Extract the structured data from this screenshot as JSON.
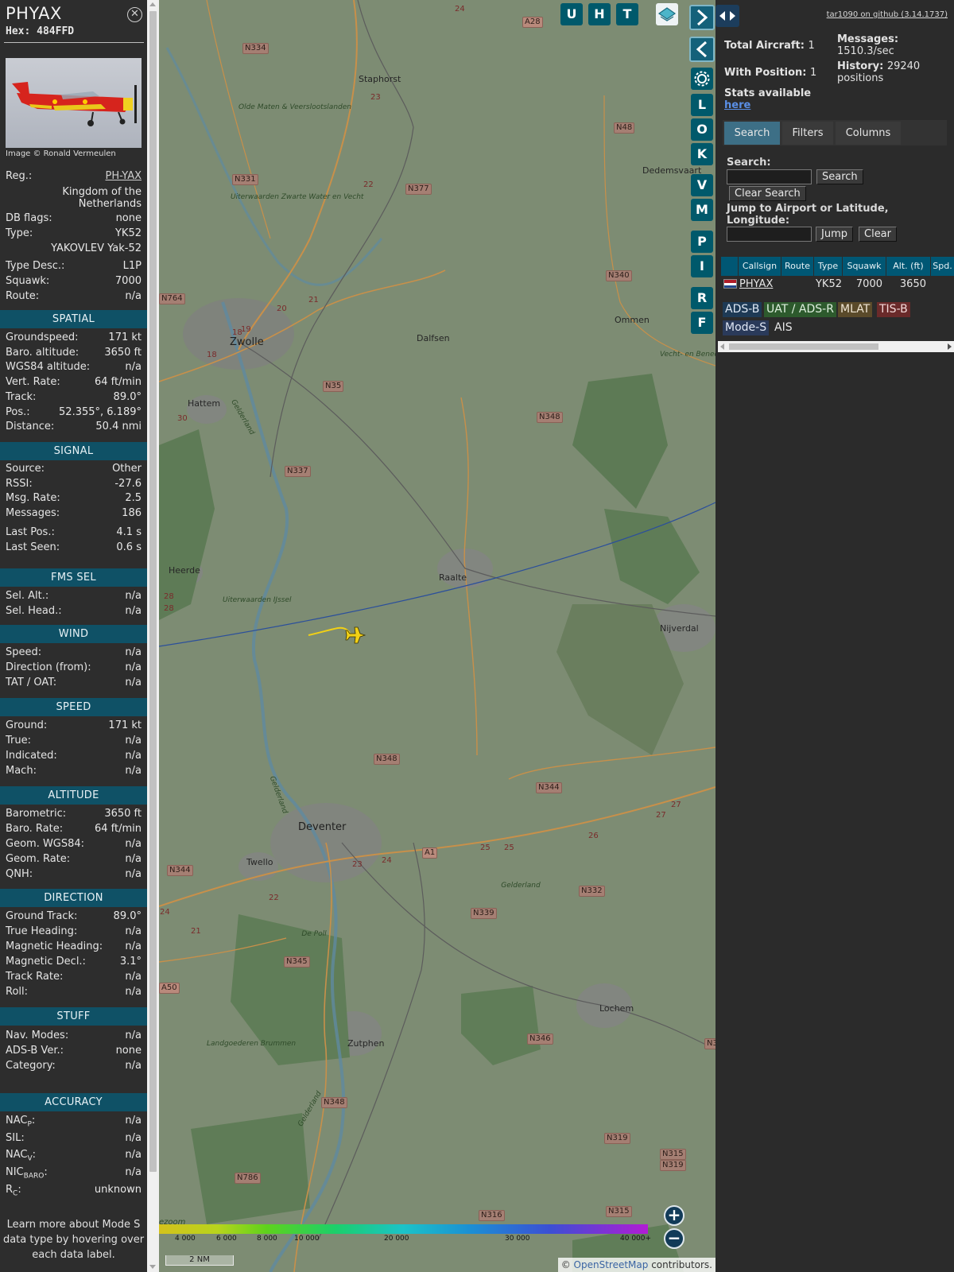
{
  "info": {
    "callsign": "PHYAX",
    "hex": "Hex: 484FFD",
    "photo_credit": "Image © Ronald Vermeulen",
    "close_icon": "close-icon",
    "reg_label": "Reg.:",
    "reg_value": "PH-YAX",
    "country": "Kingdom of the Netherlands",
    "dbflags_label": "DB flags:",
    "dbflags_value": "none",
    "type_label": "Type:",
    "type_value": "YK52",
    "type_full": "YAKOVLEV Yak-52",
    "typedesc_label": "Type Desc.:",
    "typedesc_value": "L1P",
    "squawk_label": "Squawk:",
    "squawk_value": "7000",
    "route_label": "Route:",
    "route_value": "n/a",
    "sections": {
      "spatial": "SPATIAL",
      "signal": "SIGNAL",
      "fms": "FMS SEL",
      "wind": "WIND",
      "speed": "SPEED",
      "altitude": "ALTITUDE",
      "direction": "DIRECTION",
      "stuff": "STUFF",
      "accuracy": "ACCURACY"
    },
    "spatial": [
      {
        "k": "Groundspeed:",
        "v": "171 kt"
      },
      {
        "k": "Baro. altitude:",
        "v": "3650 ft"
      },
      {
        "k": "WGS84 altitude:",
        "v": "n/a"
      },
      {
        "k": "Vert. Rate:",
        "v": "64 ft/min"
      },
      {
        "k": "Track:",
        "v": "89.0°"
      },
      {
        "k": "Pos.:",
        "v": "52.355°, 6.189°"
      },
      {
        "k": "Distance:",
        "v": "50.4 nmi"
      }
    ],
    "signal": [
      {
        "k": "Source:",
        "v": "Other"
      },
      {
        "k": "RSSI:",
        "v": "-27.6"
      },
      {
        "k": "Msg. Rate:",
        "v": "2.5"
      },
      {
        "k": "Messages:",
        "v": "186"
      },
      {
        "k": "Last Pos.:",
        "v": "4.1 s"
      },
      {
        "k": "Last Seen:",
        "v": "0.6 s"
      }
    ],
    "fms": [
      {
        "k": "Sel. Alt.:",
        "v": "n/a"
      },
      {
        "k": "Sel. Head.:",
        "v": "n/a"
      }
    ],
    "wind": [
      {
        "k": "Speed:",
        "v": "n/a"
      },
      {
        "k": "Direction (from):",
        "v": "n/a"
      },
      {
        "k": "TAT / OAT:",
        "v": "n/a"
      }
    ],
    "speed": [
      {
        "k": "Ground:",
        "v": "171 kt"
      },
      {
        "k": "True:",
        "v": "n/a"
      },
      {
        "k": "Indicated:",
        "v": "n/a"
      },
      {
        "k": "Mach:",
        "v": "n/a"
      }
    ],
    "altitude": [
      {
        "k": "Barometric:",
        "v": "3650 ft"
      },
      {
        "k": "Baro. Rate:",
        "v": "64 ft/min"
      },
      {
        "k": "Geom. WGS84:",
        "v": "n/a"
      },
      {
        "k": "Geom. Rate:",
        "v": "n/a"
      },
      {
        "k": "QNH:",
        "v": "n/a"
      }
    ],
    "direction": [
      {
        "k": "Ground Track:",
        "v": "89.0°"
      },
      {
        "k": "True Heading:",
        "v": "n/a"
      },
      {
        "k": "Magnetic Heading:",
        "v": "n/a"
      },
      {
        "k": "Magnetic Decl.:",
        "v": "3.1°"
      },
      {
        "k": "Track Rate:",
        "v": "n/a"
      },
      {
        "k": "Roll:",
        "v": "n/a"
      }
    ],
    "stuff": [
      {
        "k": "Nav. Modes:",
        "v": "n/a"
      },
      {
        "k": "ADS-B Ver.:",
        "v": "none"
      },
      {
        "k": "Category:",
        "v": "n/a"
      }
    ],
    "accuracy": [
      {
        "k": "NAC",
        "sub": "P",
        "v": "n/a"
      },
      {
        "k": "SIL:",
        "sub": "",
        "v": "n/a"
      },
      {
        "k": "NAC",
        "sub": "V",
        "v": "n/a"
      },
      {
        "k": "NIC",
        "sub": "BARO",
        "v": "n/a"
      },
      {
        "k": "R",
        "sub": "C",
        "v": "unknown"
      }
    ],
    "learn_more": "Learn more about Mode S data type by hovering over each data label."
  },
  "map": {
    "buttons_top": [
      "U",
      "H",
      "T"
    ],
    "buttons_side": [
      "L",
      "O",
      "K",
      "V",
      "M",
      "P",
      "I",
      "R",
      "F"
    ],
    "layers_icon": "layers-icon",
    "settings_icon": "gear-icon",
    "zoom_in": "+",
    "zoom_out": "−",
    "scale": "2 NM",
    "attribution_prefix": "© ",
    "attribution_link": "OpenStreetMap",
    "attribution_suffix": " contributors.",
    "altitude_legend": [
      "4 000",
      "6 000",
      "8 000",
      "10 000",
      "20 000",
      "30 000",
      "40 000+"
    ],
    "cities": [
      "Zwolle",
      "Deventer"
    ],
    "towns": [
      "Staphorst",
      "Dedemsvaart",
      "Ommen",
      "Dalfsen",
      "Hattem",
      "Heerde",
      "Raalte",
      "Nijverdal",
      "Twello",
      "Zutphen",
      "Lochem"
    ],
    "nature": [
      "Olde Maten & Veerslootslanden",
      "Uiterwaarden Zwarte Water en Vecht",
      "Uiterwaarden IJssel",
      "Vecht- en Beneden Reggegeb",
      "De Poll",
      "Landgoederen Brummen",
      "Gelderland",
      "Gelderland",
      "Gelderland",
      "Gelderland"
    ],
    "roads": [
      "N334",
      "A28",
      "N331",
      "N377",
      "N48",
      "N764",
      "N340",
      "N35",
      "N348",
      "N337",
      "N348",
      "N344",
      "N344",
      "A1",
      "N332",
      "N339",
      "N345",
      "A50",
      "N346",
      "N348",
      "N319",
      "N786",
      "N315",
      "N319",
      "N316",
      "N315",
      "N3"
    ],
    "road_numbers": [
      "24",
      "23",
      "22",
      "21",
      "20",
      "19",
      "18",
      "18",
      "30",
      "28",
      "28",
      "27",
      "27",
      "26",
      "25",
      "25",
      "24",
      "23",
      "22",
      "21",
      "24"
    ],
    "extra_labels": [
      "ezoom"
    ]
  },
  "right": {
    "github": "tar1090 on github (3.14.1737)",
    "total_aircraft_label": "Total Aircraft:",
    "total_aircraft": "1",
    "with_position_label": "With Position:",
    "with_position": "1",
    "stats_label": "Stats available",
    "stats_link": "here",
    "messages_label": "Messages:",
    "messages_value": "1510.3/sec",
    "history_label": "History:",
    "history_value": "29240 positions",
    "tabs": [
      "Search",
      "Filters",
      "Columns"
    ],
    "search_label": "Search:",
    "search_button": "Search",
    "clear_search_button": "Clear Search",
    "jump_label": "Jump to Airport or Latitude, Longitude:",
    "jump_button": "Jump",
    "clear_button": "Clear",
    "columns": [
      "Callsign",
      "Route",
      "Type",
      "Squawk",
      "Alt. (ft)",
      "Spd."
    ],
    "row": {
      "callsign": "PHYAX",
      "route": "",
      "type": "YK52",
      "squawk": "7000",
      "alt": "3650",
      "spd": ""
    },
    "badges": [
      {
        "label": "ADS-B",
        "bg": "#1e3a55",
        "fg": "#dfe9f5"
      },
      {
        "label": "UAT / ADS-R",
        "bg": "#2d5a2d",
        "fg": "#dff0df"
      },
      {
        "label": "MLAT",
        "bg": "#5a4a2a",
        "fg": "#f0e6d4"
      },
      {
        "label": "TIS-B",
        "bg": "#6a2a2a",
        "fg": "#f4dada"
      },
      {
        "label": "Mode-S",
        "bg": "#2a3a5a",
        "fg": "#dfe6f4"
      },
      {
        "label": "AIS",
        "bg": "transparent",
        "fg": "#e6e6e6"
      }
    ]
  }
}
